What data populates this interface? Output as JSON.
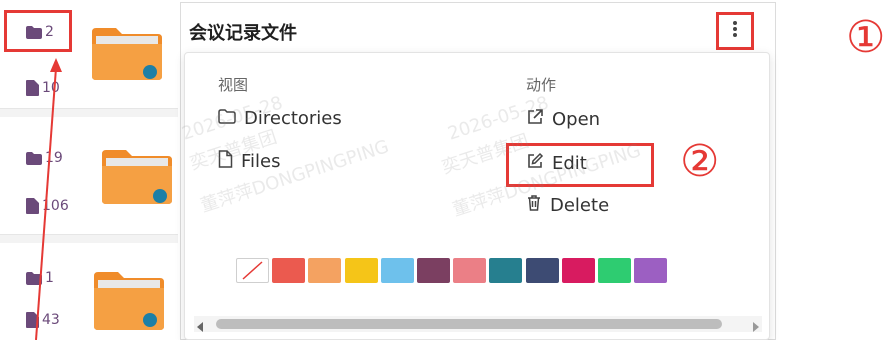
{
  "left_rows": [
    {
      "folders": "2",
      "files": "10"
    },
    {
      "folders": "19",
      "files": "106"
    },
    {
      "folders": "1",
      "files": "43"
    }
  ],
  "card": {
    "title": "会议记录文件"
  },
  "dropdown": {
    "view_header": "视图",
    "action_header": "动作",
    "view_items": [
      {
        "label": "Directories",
        "icon": "folder-outline-icon"
      },
      {
        "label": "Files",
        "icon": "file-outline-icon"
      }
    ],
    "action_items": [
      {
        "label": "Open",
        "icon": "external-link-icon"
      },
      {
        "label": "Edit",
        "icon": "pencil-square-icon"
      },
      {
        "label": "Delete",
        "icon": "trash-icon"
      }
    ],
    "swatches": [
      "none",
      "#eb5a4f",
      "#f4a261",
      "#f5c518",
      "#6ec1ec",
      "#7b3f61",
      "#eb7f86",
      "#267f8f",
      "#3d4b73",
      "#d81b60",
      "#2ecc71",
      "#9c5fc2"
    ]
  },
  "annotations": {
    "one": "①",
    "two": "②"
  },
  "watermark": {
    "date": "2026-05-28",
    "company": "奕天普集团",
    "name": "董萍萍DONGPINGPING"
  }
}
